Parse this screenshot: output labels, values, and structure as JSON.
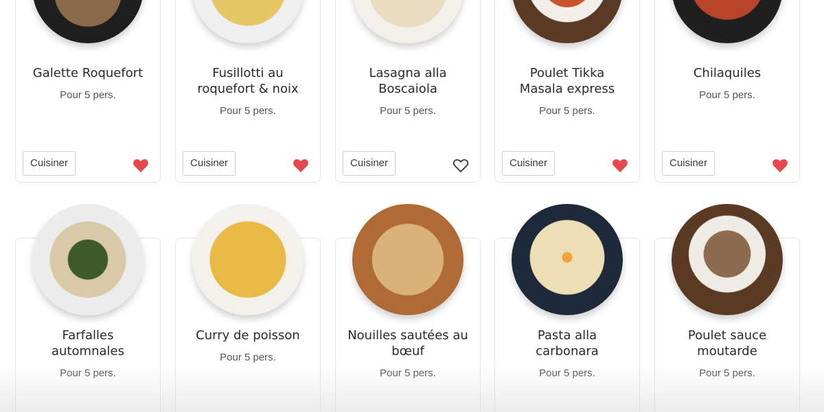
{
  "recipes_row1": [
    {
      "title_lines": [
        "Galette Roquefort"
      ],
      "servings": "Pour 5 pers.",
      "cook_label": "Cuisiner",
      "favorite": true
    },
    {
      "title_lines": [
        "Fusillotti au",
        "roquefort & noix"
      ],
      "servings": "Pour 5 pers.",
      "cook_label": "Cuisiner",
      "favorite": true
    },
    {
      "title_lines": [
        "Lasagna alla",
        "Boscaiola"
      ],
      "servings": "Pour 5 pers.",
      "cook_label": "Cuisiner",
      "favorite": false
    },
    {
      "title_lines": [
        "Poulet Tikka",
        "Masala express"
      ],
      "servings": "Pour 5 pers.",
      "cook_label": "Cuisiner",
      "favorite": true
    },
    {
      "title_lines": [
        "Chilaquiles"
      ],
      "servings": "Pour 5 pers.",
      "cook_label": "Cuisiner",
      "favorite": true
    }
  ],
  "recipes_row2": [
    {
      "title_lines": [
        "Farfalles",
        "automnales"
      ],
      "servings": "Pour 5 pers."
    },
    {
      "title_lines": [
        "Curry de poisson"
      ],
      "servings": "Pour 5 pers."
    },
    {
      "title_lines": [
        "Nouilles sautées au",
        "bœuf"
      ],
      "servings": "Pour 5 pers."
    },
    {
      "title_lines": [
        "Pasta alla",
        "carbonara"
      ],
      "servings": "Pour 5 pers."
    },
    {
      "title_lines": [
        "Poulet sauce",
        "moutarde"
      ],
      "servings": "Pour 5 pers."
    }
  ],
  "colors": {
    "heart_filled": "#e8474c",
    "heart_outline": "#333333"
  },
  "icons": {
    "favorite": "heart-icon"
  }
}
